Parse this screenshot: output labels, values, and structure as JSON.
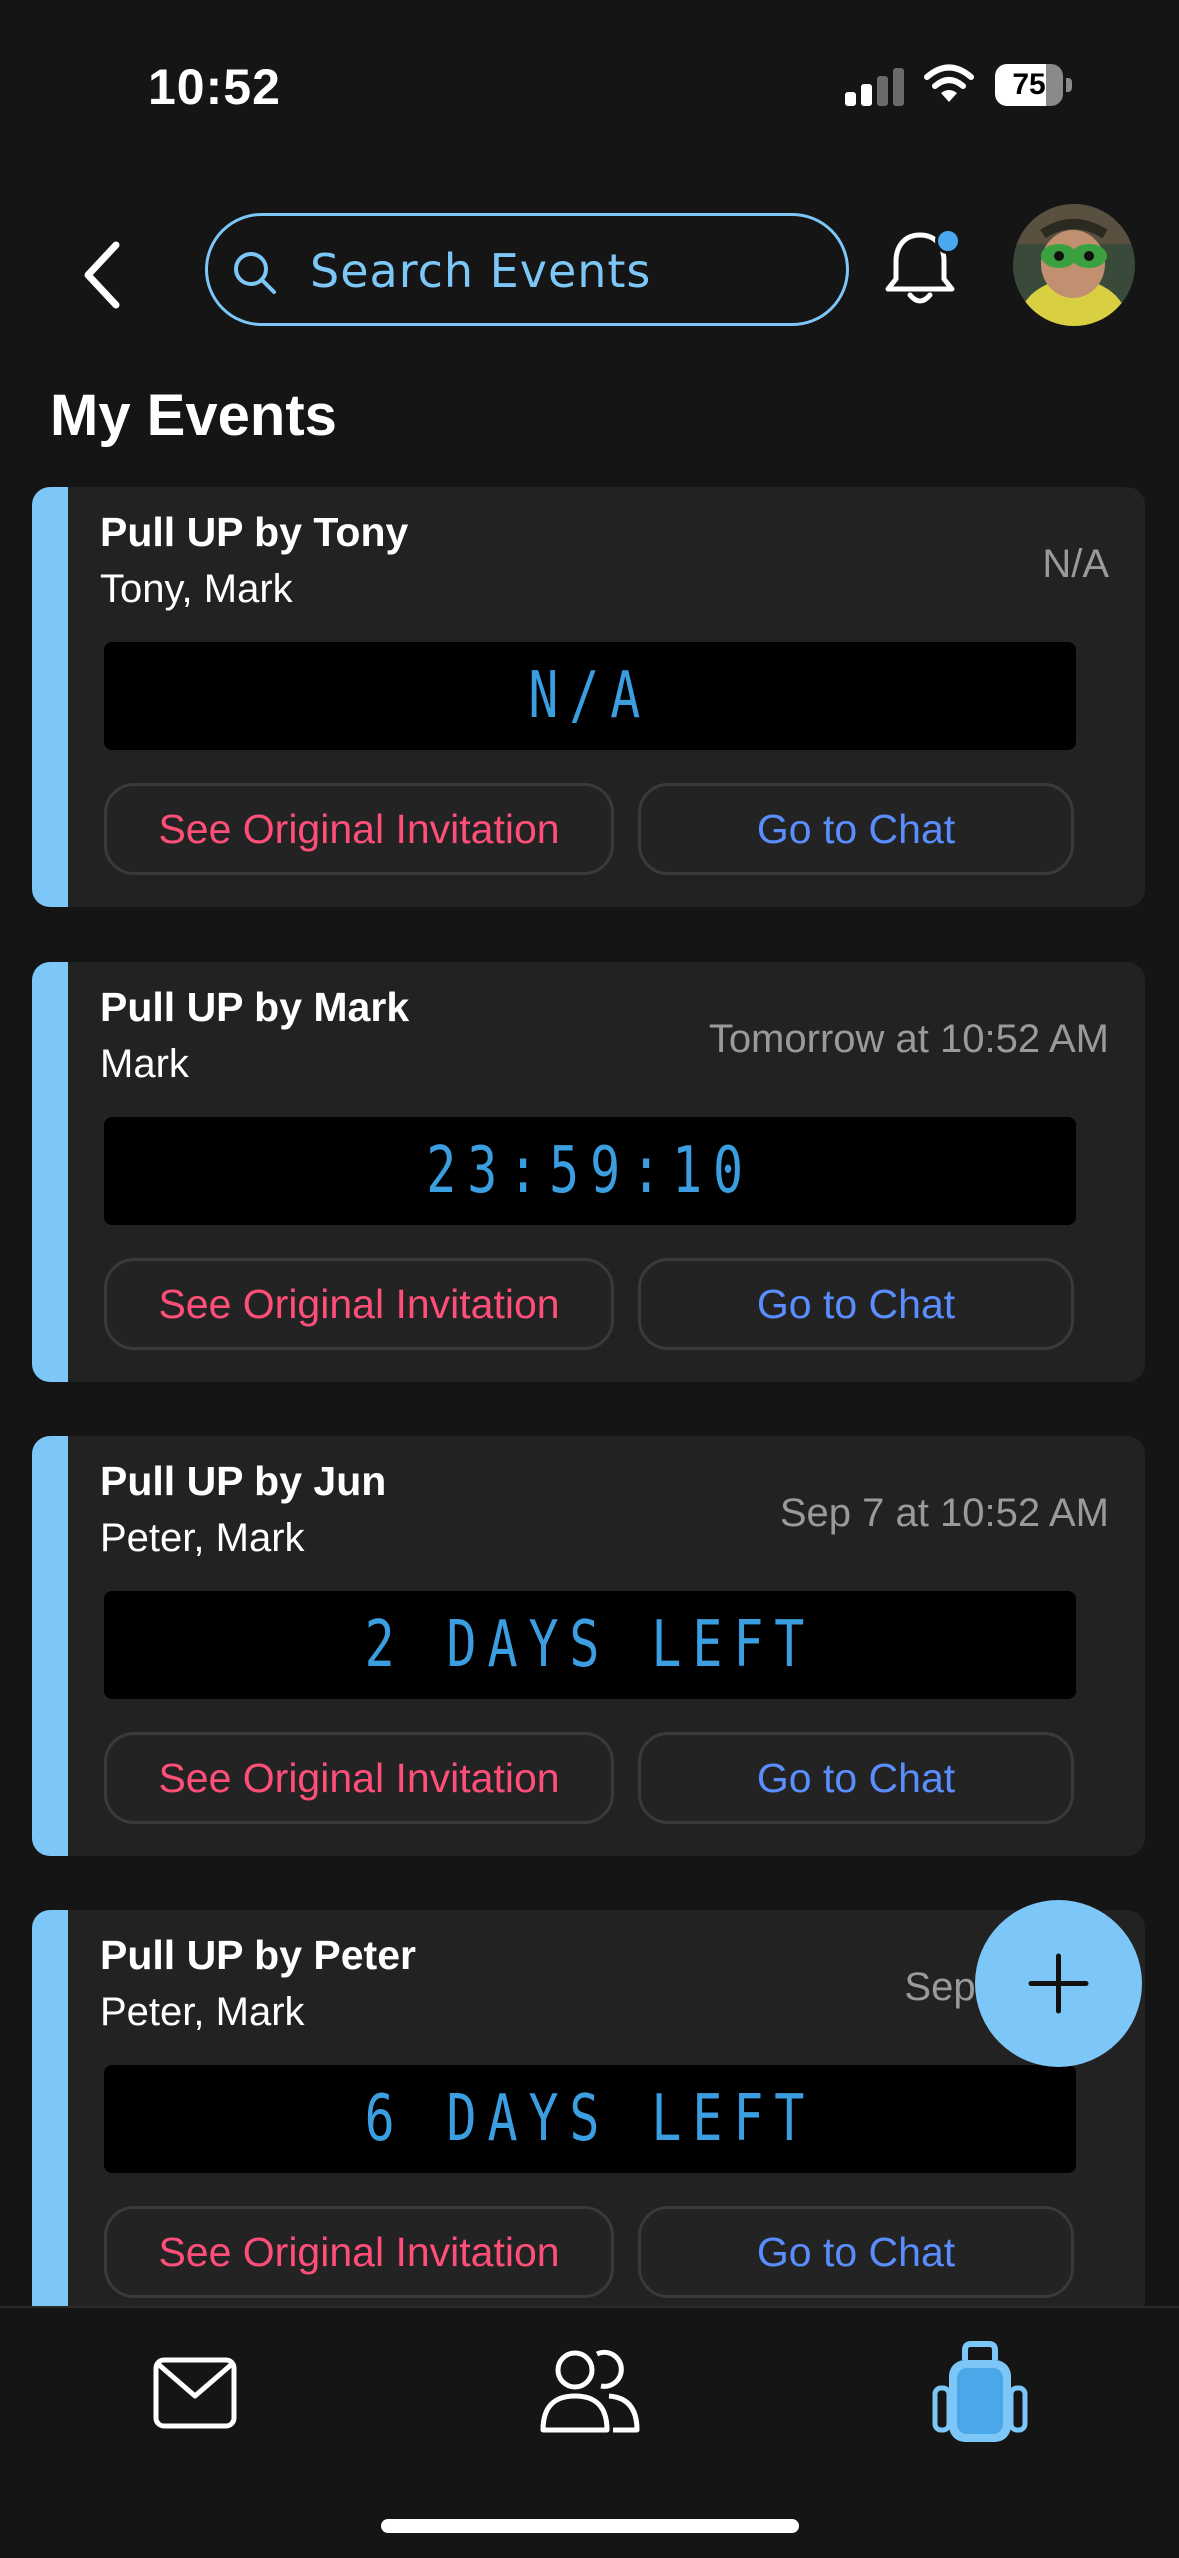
{
  "status_bar": {
    "time": "10:52",
    "battery": "75",
    "battery_level": 0.75
  },
  "header": {
    "search_placeholder": "Search Events"
  },
  "section_title": "My Events",
  "events": [
    {
      "title": "Pull UP by Tony",
      "people": "Tony, Mark",
      "time": "N/A",
      "countdown": "N/A",
      "invite_label": "See Original Invitation",
      "chat_label": "Go to Chat"
    },
    {
      "title": "Pull UP by Mark",
      "people": "Mark",
      "time": "Tomorrow at 10:52 AM",
      "countdown": "23:59:10",
      "invite_label": "See Original Invitation",
      "chat_label": "Go to Chat"
    },
    {
      "title": "Pull UP by Jun",
      "people": "Peter, Mark",
      "time": "Sep 7 at 10:52 AM",
      "countdown": "2 DAYS LEFT",
      "invite_label": "See Original Invitation",
      "chat_label": "Go to Chat"
    },
    {
      "title": "Pull UP by Peter",
      "people": "Peter, Mark",
      "time": "Sep 10 at 2",
      "countdown": "6 DAYS LEFT",
      "invite_label": "See Original Invitation",
      "chat_label": "Go to Chat"
    }
  ],
  "colors": {
    "accent": "#7cc7f7",
    "invite": "#ff4f79",
    "chat": "#5a8eff",
    "lcd": "#3a9ee0"
  },
  "icons": {
    "tabs": [
      "mail-icon",
      "people-icon",
      "backpack-icon"
    ],
    "fab": "plus-icon"
  }
}
